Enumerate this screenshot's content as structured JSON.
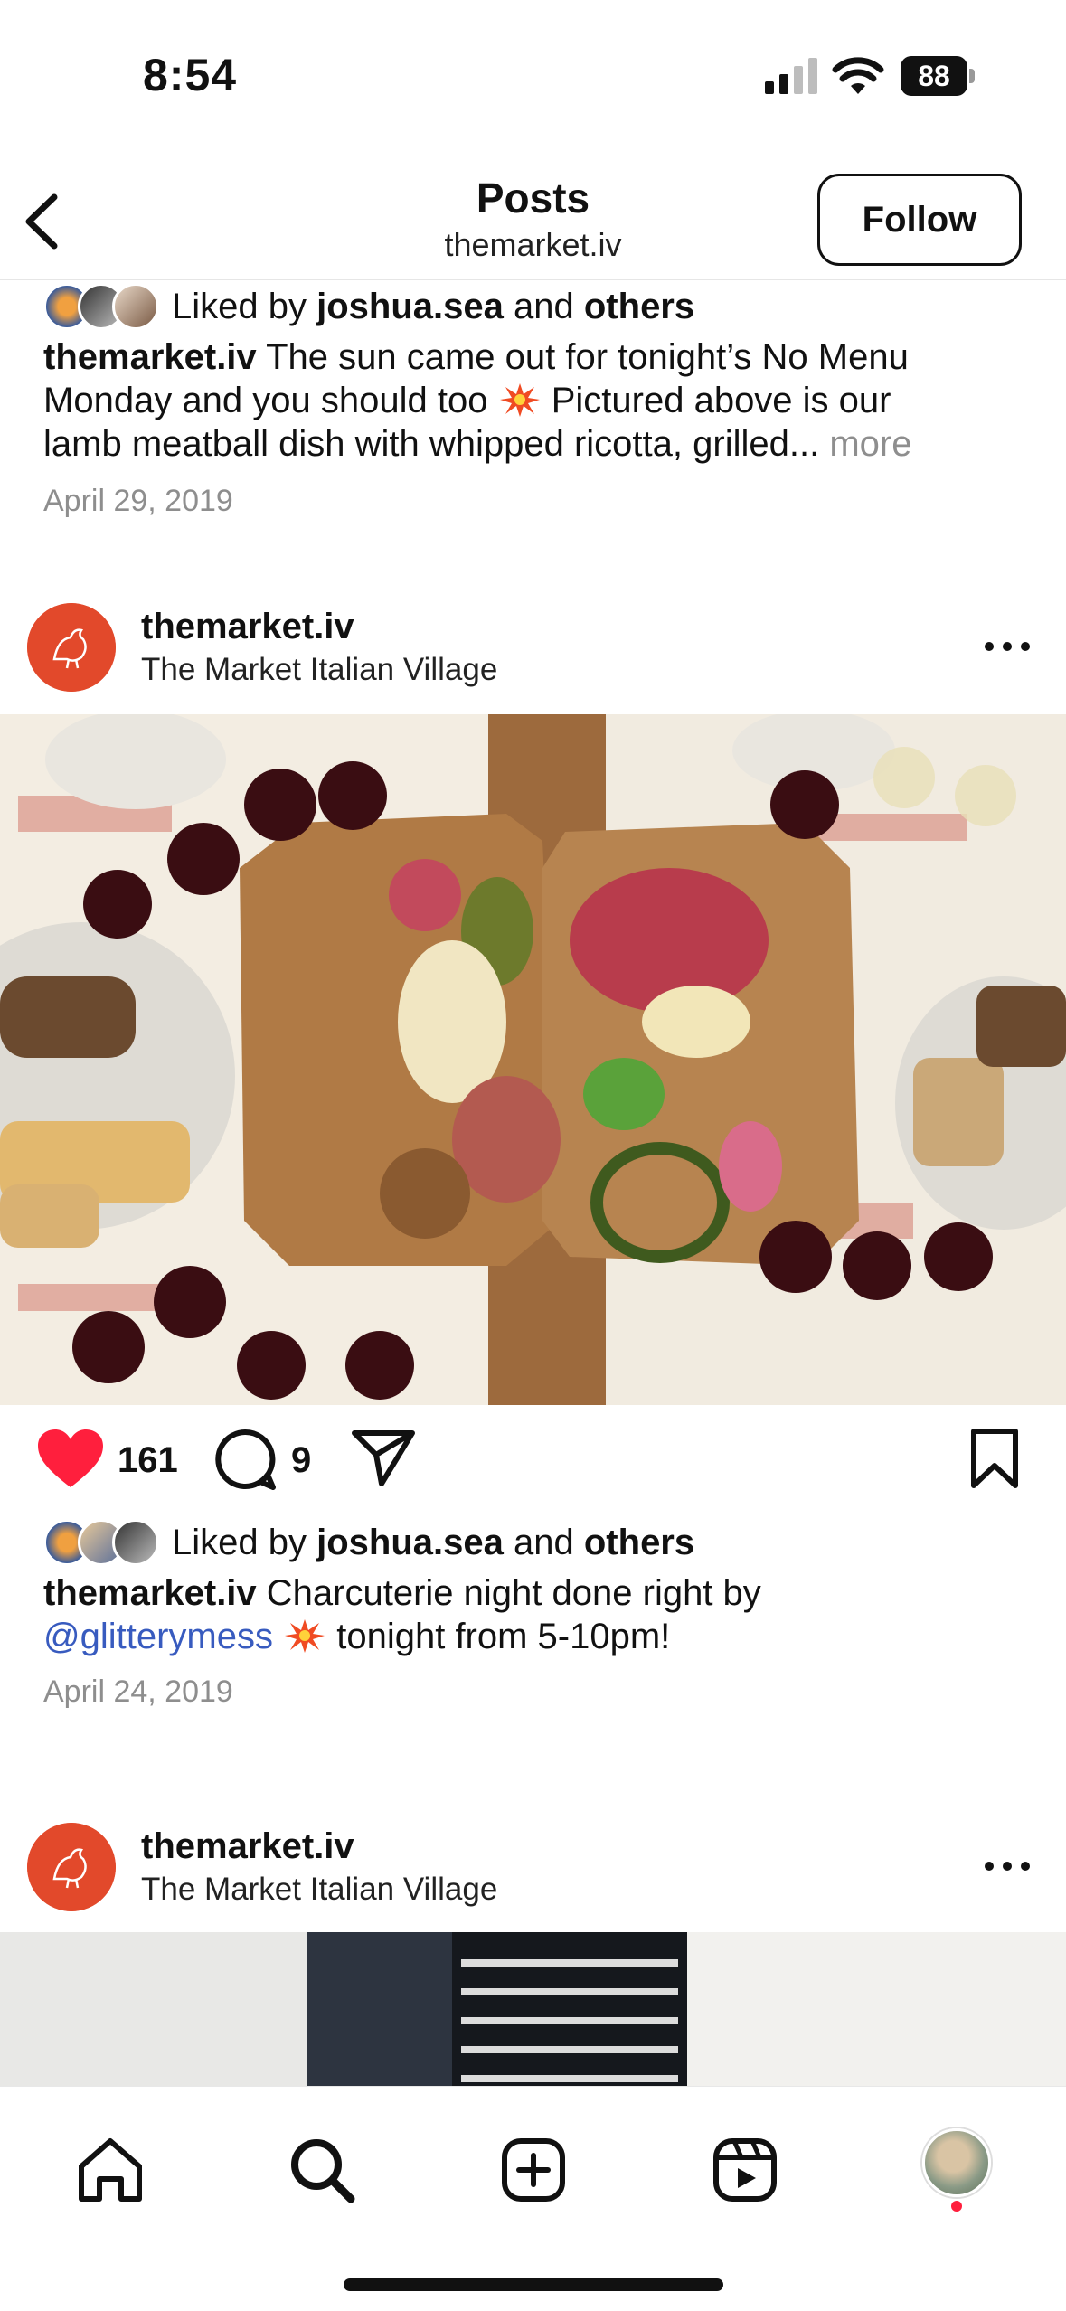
{
  "status_bar": {
    "time": "8:54",
    "battery": "88"
  },
  "header": {
    "title": "Posts",
    "subtitle": "themarket.iv",
    "follow_label": "Follow"
  },
  "post_prev": {
    "liked_by_prefix": "Liked by",
    "liked_by_user": "joshua.sea",
    "liked_by_and": "and",
    "liked_by_others": "others",
    "caption_user": "themarket.iv",
    "caption_line1": "The sun came out for tonight’s No Menu",
    "caption_line2": "Monday and you should too",
    "caption_line2b": "Pictured above is our",
    "caption_line3": "lamb meatball dish with whipped ricotta, grilled...",
    "more_label": "more",
    "date": "April 29, 2019"
  },
  "post_main": {
    "username": "themarket.iv",
    "location": "The Market Italian Village",
    "likes_count": "161",
    "comments_count": "9",
    "liked_by_prefix": "Liked by",
    "liked_by_user": "joshua.sea",
    "liked_by_and": "and",
    "liked_by_others": "others",
    "caption_user": "themarket.iv",
    "caption_text": "Charcuterie night done right by",
    "mention": "@glitterymess",
    "caption_text2": "tonight from 5-10pm!",
    "date": "April 24, 2019"
  },
  "post_next": {
    "username": "themarket.iv",
    "location": "The Market Italian Village"
  },
  "colors": {
    "accent_red": "#ff1f3d",
    "mention_blue": "#385bbf",
    "avatar_orange": "#e2492b"
  },
  "icons": [
    "back-icon",
    "heart-icon",
    "comment-icon",
    "share-icon",
    "bookmark-icon",
    "more-icon",
    "home-icon",
    "search-icon",
    "create-icon",
    "reels-icon"
  ]
}
